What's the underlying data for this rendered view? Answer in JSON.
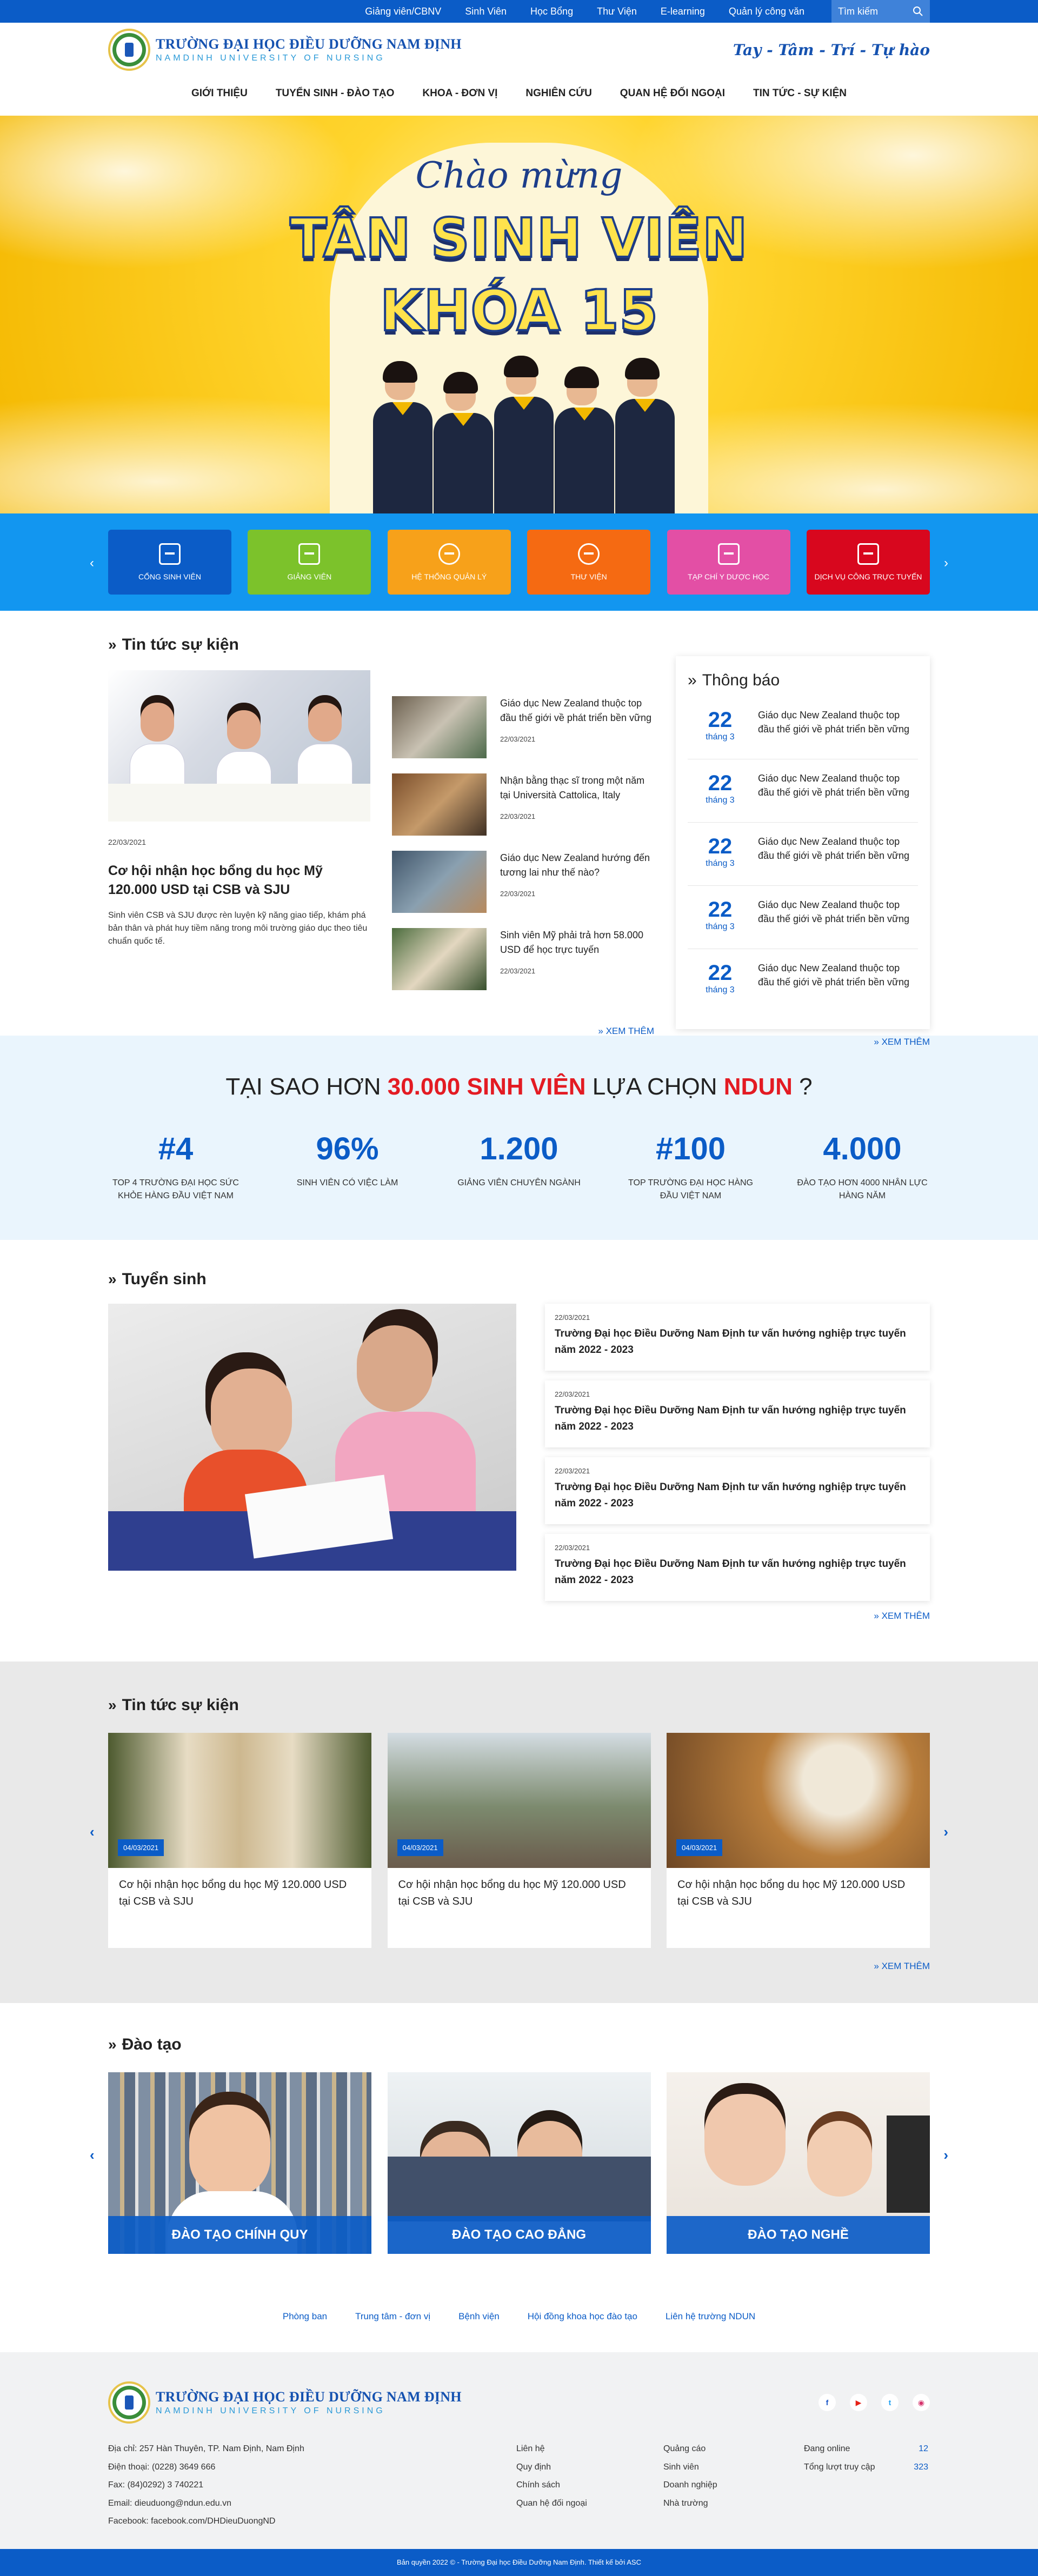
{
  "topbar": {
    "links": [
      "Giảng viên/CBNV",
      "Sinh Viên",
      "Học Bổng",
      "Thư Viện",
      "E-learning",
      "Quản lý công văn"
    ],
    "search_placeholder": "Tìm kiếm"
  },
  "header": {
    "logo_name": "TRƯỜNG ĐẠI HỌC ĐIỀU DƯỠNG NAM ĐỊNH",
    "logo_sub": "NAMDINH UNIVERSITY OF NURSING",
    "slogan": "Tay - Tâm - Trí - Tự hào"
  },
  "nav": [
    "GIỚI THIỆU",
    "TUYỂN SINH - ĐÀO TẠO",
    "KHOA - ĐƠN VỊ",
    "NGHIÊN CỨU",
    "QUAN HỆ ĐỐI NGOẠI",
    "TIN TỨC - SỰ KIỆN"
  ],
  "hero": {
    "script": "Chào mừng",
    "line1": "TÂN SINH VIÊN",
    "line2": "KHÓA 15"
  },
  "quick_links": [
    {
      "label": "CỔNG SINH VIÊN",
      "color": "#0b5cc7",
      "icon": "building-icon"
    },
    {
      "label": "GIẢNG VIÊN",
      "color": "#7cc22b",
      "icon": "briefcase-icon"
    },
    {
      "label": "HỆ THỐNG QUẢN LÝ",
      "color": "#f7a11a",
      "icon": "gear-icon"
    },
    {
      "label": "THƯ VIỆN",
      "color": "#f56a12",
      "icon": "globe-icon"
    },
    {
      "label": "TẠP CHÍ Y DƯỢC HỌC",
      "color": "#e34fa5",
      "icon": "book-icon"
    },
    {
      "label": "DỊCH VỤ CÔNG TRỰC TUYẾN",
      "color": "#d8071e",
      "icon": "briefcase-icon"
    }
  ],
  "news": {
    "title": "Tin tức sự kiện",
    "featured": {
      "date": "22/03/2021",
      "title": "Cơ hội nhận học bổng du học Mỹ 120.000 USD tại CSB và SJU",
      "desc": "Sinh viên CSB và SJU được rèn luyện kỹ năng giao tiếp, khám phá bản thân và phát huy tiềm năng trong môi trường giáo dục theo tiêu chuẩn quốc tế."
    },
    "items": [
      {
        "title": "Giáo dục New Zealand thuộc top đầu thế giới về phát triển bền vững",
        "date": "22/03/2021"
      },
      {
        "title": "Nhận bằng thạc sĩ trong một năm tại Università Cattolica, Italy",
        "date": "22/03/2021"
      },
      {
        "title": "Giáo dục New Zealand hướng đến tương lai như thế nào?",
        "date": "22/03/2021"
      },
      {
        "title": "Sinh viên Mỹ phải trả hơn 58.000 USD để học trực tuyến",
        "date": "22/03/2021"
      }
    ],
    "more": "XEM THÊM"
  },
  "notices": {
    "title": "Thông báo",
    "items": [
      {
        "day": "22",
        "month": "tháng 3",
        "title": "Giáo dục New Zealand thuộc top đầu thế giới về phát triển bền vững"
      },
      {
        "day": "22",
        "month": "tháng 3",
        "title": "Giáo dục New Zealand thuộc top đầu thế giới về phát triển bền vững"
      },
      {
        "day": "22",
        "month": "tháng 3",
        "title": "Giáo dục New Zealand thuộc top đầu thế giới về phát triển bền vững"
      },
      {
        "day": "22",
        "month": "tháng 3",
        "title": "Giáo dục New Zealand thuộc top đầu thế giới về phát triển bền vững"
      },
      {
        "day": "22",
        "month": "tháng 3",
        "title": "Giáo dục New Zealand thuộc top đầu thế giới về phát triển bền vững"
      }
    ],
    "more": "XEM THÊM"
  },
  "why": {
    "pre": "TẠI SAO HƠN ",
    "highlight": "30.000 SINH VIÊN",
    "mid": " LỰA CHỌN ",
    "brand": "NDUN",
    "post": " ?",
    "stats": [
      {
        "num": "#4",
        "label": "TOP 4 TRƯỜNG ĐẠI HỌC SỨC KHỎE HÀNG ĐẦU VIỆT NAM"
      },
      {
        "num": "96%",
        "label": "SINH VIÊN CÓ VIỆC LÀM"
      },
      {
        "num": "1.200",
        "label": "GIẢNG VIÊN CHUYÊN NGÀNH"
      },
      {
        "num": "#100",
        "label": "TOP TRƯỜNG ĐẠI HỌC HÀNG ĐẦU VIỆT NAM"
      },
      {
        "num": "4.000",
        "label": "ĐÀO TẠO HƠN 4000 NHÂN LỰC HÀNG NĂM"
      }
    ]
  },
  "admissions": {
    "title": "Tuyển sinh",
    "items": [
      {
        "date": "22/03/2021",
        "title": "Trường Đại học Điều Dưỡng Nam Định tư vấn hướng nghiệp trực tuyến năm 2022 - 2023"
      },
      {
        "date": "22/03/2021",
        "title": "Trường Đại học Điều Dưỡng Nam Định tư vấn hướng nghiệp trực tuyến năm 2022 - 2023"
      },
      {
        "date": "22/03/2021",
        "title": "Trường Đại học Điều Dưỡng Nam Định tư vấn hướng nghiệp trực tuyến năm 2022 - 2023"
      },
      {
        "date": "22/03/2021",
        "title": "Trường Đại học Điều Dưỡng Nam Định tư vấn hướng nghiệp trực tuyến năm 2022 - 2023"
      }
    ],
    "more": "XEM THÊM"
  },
  "events": {
    "title": "Tin tức sự kiện",
    "items": [
      {
        "date": "04/03/2021",
        "title": "Cơ hội nhận học bổng du học Mỹ 120.000 USD tại CSB và SJU"
      },
      {
        "date": "04/03/2021",
        "title": "Cơ hội nhận học bổng du học Mỹ 120.000 USD tại CSB và SJU"
      },
      {
        "date": "04/03/2021",
        "title": "Cơ hội nhận học bổng du học Mỹ 120.000 USD tại CSB và SJU"
      }
    ],
    "more": "XEM THÊM"
  },
  "training": {
    "title": "Đào tạo",
    "items": [
      "ĐÀO TẠO CHÍNH QUY",
      "ĐÀO TẠO CAO ĐẲNG",
      "ĐÀO TẠO NGHỀ"
    ]
  },
  "footer_links": [
    "Phòng ban",
    "Trung tâm - đơn vị",
    "Bệnh viện",
    "Hội đồng khoa học đào tạo",
    "Liên hệ trường NDUN"
  ],
  "footer": {
    "address": "Địa chỉ: 257 Hàn Thuyên, TP. Nam Định, Nam Định",
    "phone": "Điện thoại: (0228) 3649 666",
    "fax": "Fax: (84)0292) 3 740221",
    "email": "Email: dieuduong@ndun.edu.vn",
    "facebook": "Facebook: facebook.com/DHDieuDuongND",
    "col1": [
      "Liên hệ",
      "Quy định",
      "Chính sách",
      "Quan hệ đối ngoại"
    ],
    "col2": [
      "Quảng cáo",
      "Sinh viên",
      "Doanh nghiệp",
      "Nhà trường"
    ],
    "online_label": "Đang online",
    "online_value": "12",
    "visits_label": "Tổng lượt truy cập",
    "visits_value": "323",
    "copyright": "Bản quyền 2022 © - Trường Đại học Điều Dưỡng Nam Định. Thiết kế bởi ASC"
  }
}
